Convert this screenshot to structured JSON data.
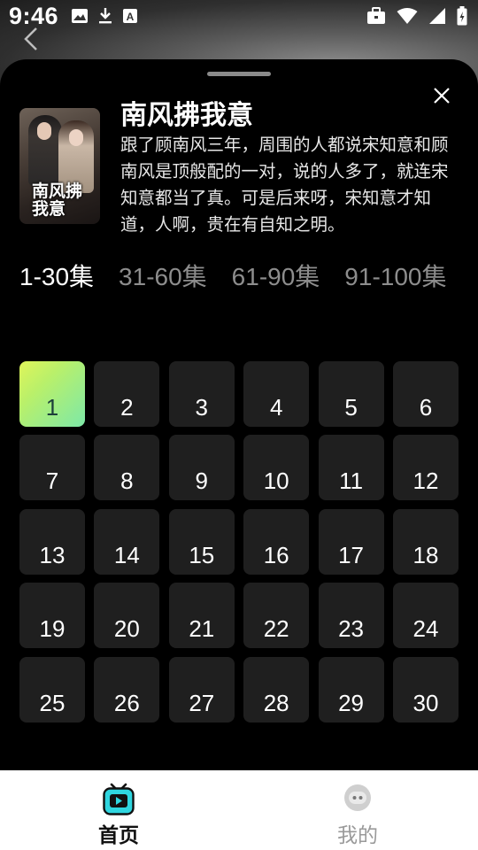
{
  "status": {
    "time": "9:46",
    "icons_left": [
      "image-icon",
      "download-icon",
      "text-a-icon"
    ],
    "icons_right": [
      "briefcase-icon",
      "wifi-icon",
      "signal-icon",
      "battery-icon"
    ]
  },
  "show": {
    "title": "南风拂我意",
    "poster_title": "南风拂我意",
    "synopsis": "跟了顾南风三年，周围的人都说宋知意和顾南风是顶般配的一对，说的人多了，就连宋知意都当了真。可是后来呀，宋知意才知道，人啊，贵在有自知之明。"
  },
  "range_tabs": [
    {
      "label": "1-30集",
      "active": true
    },
    {
      "label": "31-60集",
      "active": false
    },
    {
      "label": "61-90集",
      "active": false
    },
    {
      "label": "91-100集",
      "active": false
    }
  ],
  "episodes": [
    "1",
    "2",
    "3",
    "4",
    "5",
    "6",
    "7",
    "8",
    "9",
    "10",
    "11",
    "12",
    "13",
    "14",
    "15",
    "16",
    "17",
    "18",
    "19",
    "20",
    "21",
    "22",
    "23",
    "24",
    "25",
    "26",
    "27",
    "28",
    "29",
    "30"
  ],
  "active_episode": "1",
  "nav": {
    "home": "首页",
    "me": "我的"
  },
  "colors": {
    "accent_gradient_start": "#dff55a",
    "accent_gradient_end": "#7de8a8",
    "tv_icon": "#2fd6e0",
    "sheet_bg": "#000000",
    "tile_bg": "#1f1f1f"
  }
}
